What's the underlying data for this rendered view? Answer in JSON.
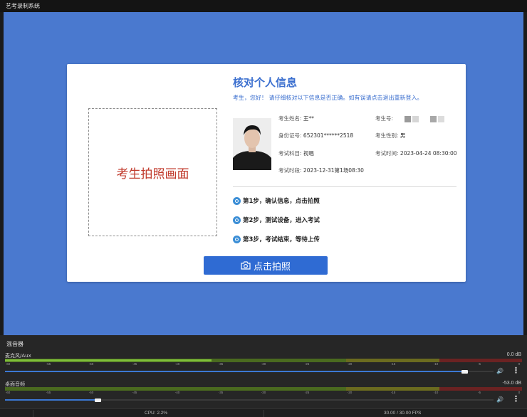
{
  "window": {
    "title": "艺考录制系统"
  },
  "card": {
    "camera_placeholder": "考生拍照画面",
    "title": "核对个人信息",
    "subtitle": "考生，您好！ 请仔细核对以下信息是否正确。如有误请点击退出重新登入。",
    "fields": {
      "name_label": "考生姓名:",
      "name_value": "王**",
      "id_label": "考生号:",
      "idcard_label": "身份证号:",
      "idcard_value": "652301******2518",
      "gender_label": "考生性别:",
      "gender_value": "男",
      "subject_label": "考试科目:",
      "subject_value": "视唱",
      "time_label": "考试时间:",
      "time_value": "2023-04-24 08:30:00",
      "period_label": "考试时段:",
      "period_value": "2023-12-31第1场08:30"
    },
    "steps": [
      "第1步，确认信息，点击拍照",
      "第2步，测试设备，进入考试",
      "第3步，考试结束，等待上传"
    ],
    "snap_button": "点击拍照"
  },
  "mixer": {
    "title": "混音器",
    "tracks": [
      {
        "name": "麦克风/Aux",
        "db": "0.0 dB",
        "level": 0.4,
        "volume": 0.94
      },
      {
        "name": "桌面音频",
        "db": "-53.0 dB",
        "level": 0.0,
        "volume": 0.19
      }
    ],
    "ticks": [
      "-60",
      "-55",
      "-50",
      "-45",
      "-40",
      "-35",
      "-30",
      "-25",
      "-20",
      "-15",
      "-10",
      "-5",
      "0"
    ]
  },
  "status": {
    "cpu": "CPU: 2.2%",
    "fps": "30.00 / 30.00 FPS"
  },
  "colors": {
    "stage": "#4a79cf",
    "accent": "#3b6fcf",
    "placeholder_text": "#c0392b",
    "button": "#2f6bd3"
  }
}
